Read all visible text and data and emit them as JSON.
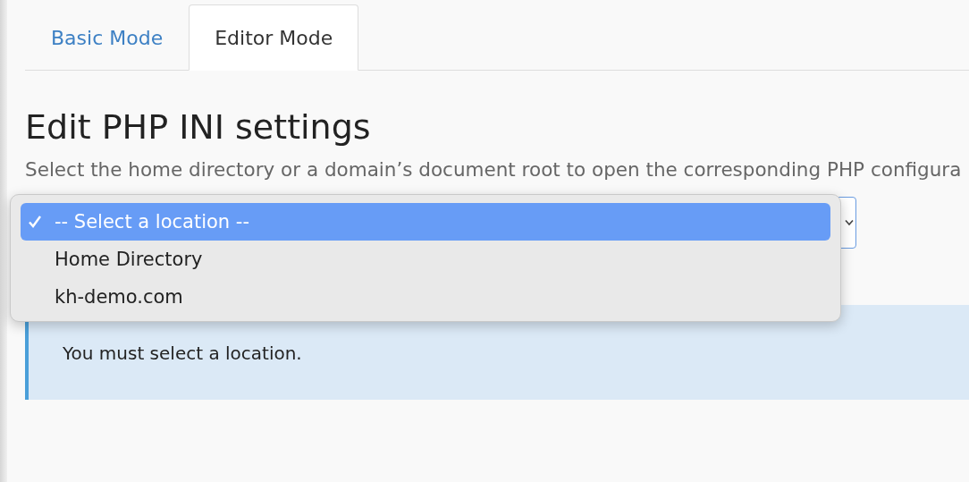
{
  "tabs": [
    {
      "label": "Basic Mode",
      "selected": false
    },
    {
      "label": "Editor Mode",
      "selected": true
    }
  ],
  "heading": "Edit PHP INI settings",
  "description": "Select the home directory or a domain’s document root to open the corresponding PHP configura",
  "location_select": {
    "expanded": true,
    "options": [
      {
        "label": "-- Select a location --",
        "selected": true
      },
      {
        "label": "Home Directory",
        "selected": false
      },
      {
        "label": "kh-demo.com",
        "selected": false
      }
    ]
  },
  "alert": {
    "message": "You must select a location."
  }
}
